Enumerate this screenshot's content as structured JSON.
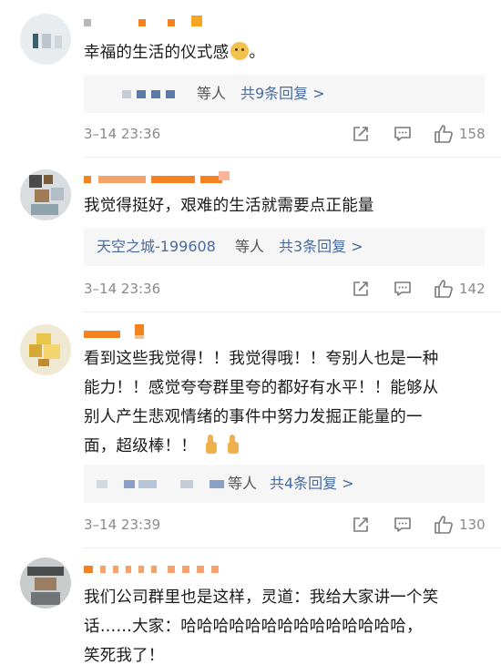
{
  "comments": [
    {
      "text": "幸福的生活的仪式感",
      "tail": "。",
      "reply_named": "",
      "reply_suffix": "等人",
      "reply_more": "共9条回复 >",
      "time": "3–14 23:36",
      "likes": "158"
    },
    {
      "text": "我觉得挺好，艰难的生活就需要点正能量",
      "reply_named": "天空之城-199608",
      "reply_suffix": "等人",
      "reply_more": "共3条回复 >",
      "time": "3–14 23:36",
      "likes": "142"
    },
    {
      "lines": [
        "看到这些我觉得！！我觉得哦！！夸别人也是一种",
        "能力！！感觉夸夸群里夸的都好有水平！！能够从",
        "别人产生悲观情绪的事件中努力发掘正能量的一",
        "面，超级棒！！"
      ],
      "reply_named": "",
      "reply_suffix": "等人",
      "reply_more": "共4条回复 >",
      "time": "3–14 23:39",
      "likes": "130"
    },
    {
      "lines": [
        "我们公司群里也是这样，灵道：我给大家讲一个笑",
        "话……大家：哈哈哈哈哈哈哈哈哈哈哈哈哈哈，",
        "笑死我了！"
      ]
    }
  ],
  "colors": {
    "link": "#496b9d",
    "meta": "#8a8a8a",
    "reply_bg": "#f6f6f6",
    "accent": "#f58220"
  },
  "icons": {
    "share": "share-icon",
    "comment": "comment-icon",
    "like": "thumbs-up-icon",
    "emoji_doge": "doge-emoji",
    "emoji_thumb": "thumbs-up-emoji"
  }
}
